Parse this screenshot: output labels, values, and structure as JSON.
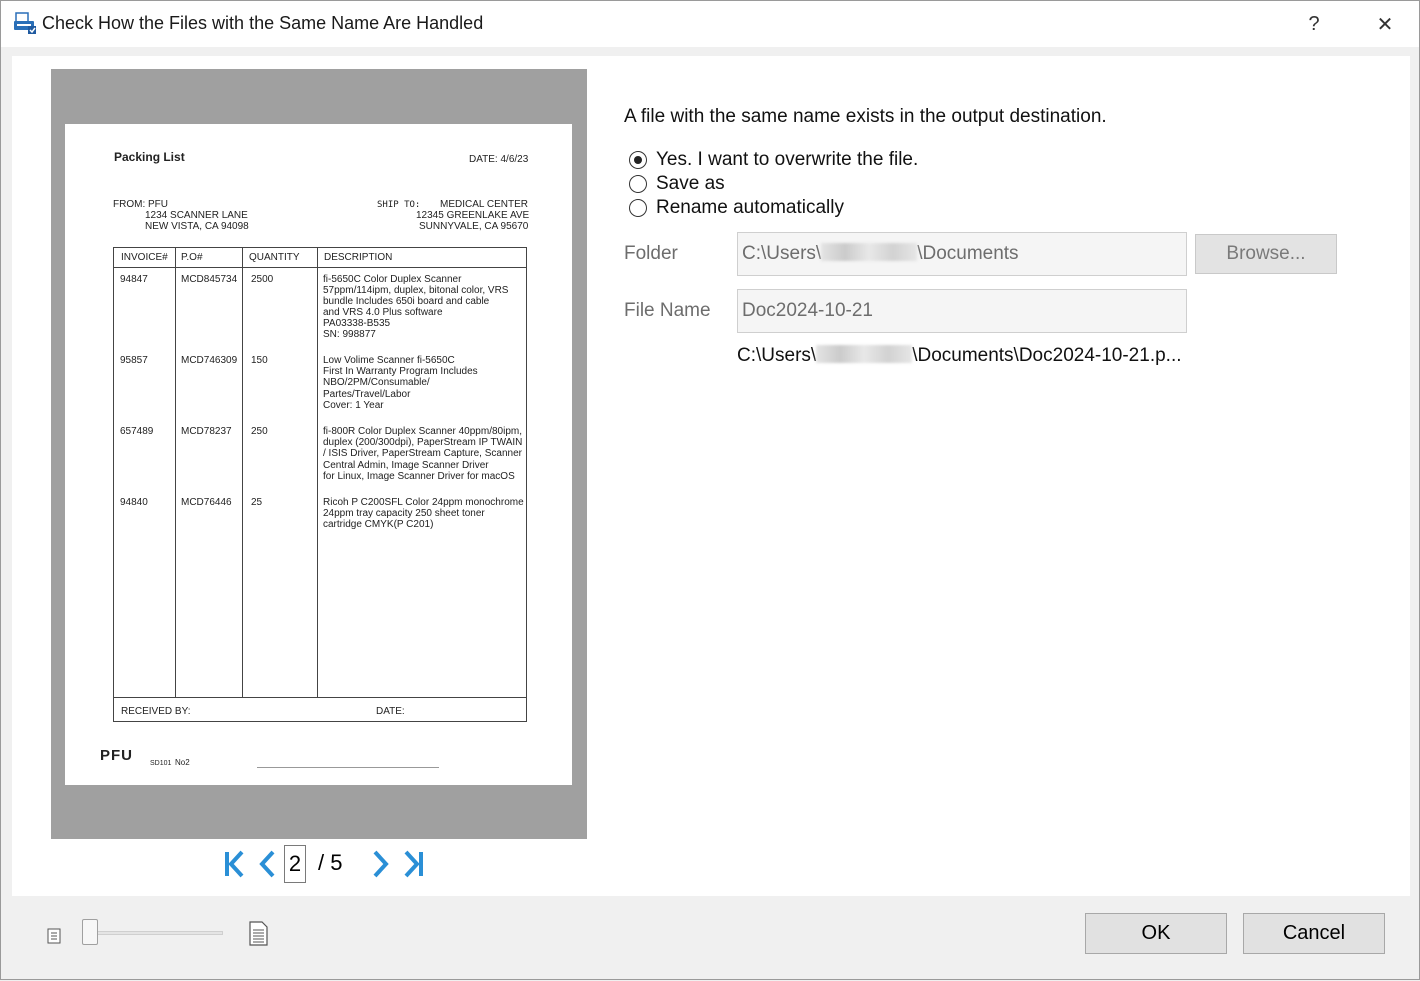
{
  "window": {
    "title": "Check How the Files with the Same Name Are Handled",
    "help_label": "?",
    "close_label": "✕"
  },
  "preview": {
    "document": {
      "heading": "Packing List",
      "date": "DATE: 4/6/23",
      "from_label": "FROM: PFU",
      "from_line1": "1234 SCANNER LANE",
      "from_line2": "NEW VISTA, CA 94098",
      "ship_to_label": "SHIP TO:",
      "ship_to_line1": "MEDICAL CENTER",
      "ship_to_line2": "12345 GREENLAKE AVE",
      "ship_to_line3": "SUNNYVALE, CA 95670",
      "columns": [
        "INVOICE#",
        "P.O#",
        "QUANTITY",
        "DESCRIPTION"
      ],
      "rows": [
        {
          "invoice": "94847",
          "po": "MCD845734",
          "quantity": "2500",
          "description": [
            "fi-5650C Color Duplex Scanner",
            "57ppm/114ipm, duplex, bitonal color, VRS",
            "bundle Includes 650i board and cable",
            "and VRS 4.0 Plus software",
            "PA03338-B535",
            "SN: 998877"
          ]
        },
        {
          "invoice": "95857",
          "po": "MCD746309",
          "quantity": "150",
          "description": [
            "Low Volime Scanner fi-5650C",
            "First In Warranty Program Includes",
            "NBO/2PM/Consumable/",
            "Partes/Travel/Labor",
            "Cover: 1 Year"
          ]
        },
        {
          "invoice": "657489",
          "po": "MCD78237",
          "quantity": "250",
          "description": [
            "fi-800R Color Duplex Scanner 40ppm/80ipm,",
            "duplex (200/300dpi), PaperStream IP TWAIN",
            "/ ISIS Driver, PaperStream Capture, Scanner",
            "Central Admin, Image Scanner Driver",
            "for Linux, Image Scanner Driver for macOS"
          ]
        },
        {
          "invoice": "94840",
          "po": "MCD76446",
          "quantity": "25",
          "description": [
            "Ricoh P C200SFL Color 24ppm monochrome",
            "24ppm tray capacity 250 sheet toner",
            "cartridge CMYK(P C201)"
          ]
        }
      ],
      "received_by": "RECEIVED BY:",
      "footer_date": "DATE:",
      "logo_text": "PFU",
      "form_code": "SD101",
      "form_no": "No2"
    },
    "pager": {
      "current_page": "2",
      "total": "/ 5"
    }
  },
  "dialog": {
    "message": "A file with the same name exists in the output destination.",
    "options": [
      {
        "label": "Yes. I want to overwrite the file.",
        "selected": true
      },
      {
        "label": "Save as",
        "selected": false
      },
      {
        "label": "Rename automatically",
        "selected": false
      }
    ],
    "folder_label": "Folder",
    "folder_prefix": "C:\\Users\\",
    "folder_suffix": "\\Documents",
    "browse_label": "Browse...",
    "filename_label": "File Name",
    "filename_value": "Doc2024-10-21",
    "full_path_prefix": "C:\\Users\\",
    "full_path_suffix": "\\Documents\\Doc2024-10-21.p..."
  },
  "footer": {
    "ok_label": "OK",
    "cancel_label": "Cancel",
    "zoom_level": 0
  },
  "colors": {
    "accent_blue": "#2a8fd6",
    "preview_bg": "#a0a0a0"
  }
}
